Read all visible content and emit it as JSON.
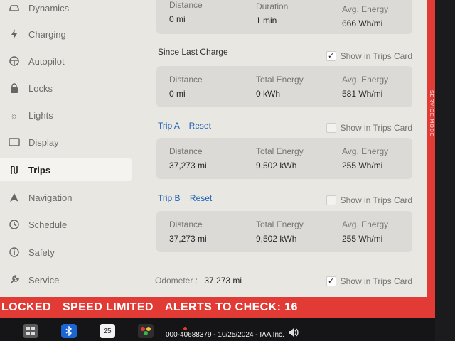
{
  "sidebar": {
    "items": [
      {
        "label": "Dynamics",
        "icon": "car-icon"
      },
      {
        "label": "Charging",
        "icon": "bolt-icon"
      },
      {
        "label": "Autopilot",
        "icon": "steering-wheel-icon"
      },
      {
        "label": "Locks",
        "icon": "lock-icon"
      },
      {
        "label": "Lights",
        "icon": "sun-icon"
      },
      {
        "label": "Display",
        "icon": "display-icon"
      },
      {
        "label": "Trips",
        "icon": "trips-icon",
        "active": true
      },
      {
        "label": "Navigation",
        "icon": "navigation-arrow-icon"
      },
      {
        "label": "Schedule",
        "icon": "clock-icon"
      },
      {
        "label": "Safety",
        "icon": "info-icon"
      },
      {
        "label": "Service",
        "icon": "wrench-icon"
      }
    ]
  },
  "current_drive": {
    "distance_label": "Distance",
    "distance": "0 mi",
    "duration_label": "Duration",
    "duration": "1 min",
    "energy_label": "Avg. Energy",
    "energy": "666 Wh/mi"
  },
  "since_last_charge": {
    "title": "Since Last Charge",
    "show_in_trips_label": "Show in Trips Card",
    "show_in_trips_checked": true,
    "distance_label": "Distance",
    "distance": "0 mi",
    "total_energy_label": "Total Energy",
    "total_energy": "0 kWh",
    "energy_label": "Avg. Energy",
    "energy": "581 Wh/mi"
  },
  "trip_a": {
    "title": "Trip A",
    "reset_label": "Reset",
    "show_in_trips_label": "Show in Trips Card",
    "show_in_trips_checked": false,
    "distance_label": "Distance",
    "distance": "37,273 mi",
    "total_energy_label": "Total Energy",
    "total_energy": "9,502 kWh",
    "energy_label": "Avg. Energy",
    "energy": "255 Wh/mi"
  },
  "trip_b": {
    "title": "Trip B",
    "reset_label": "Reset",
    "show_in_trips_label": "Show in Trips Card",
    "show_in_trips_checked": false,
    "distance_label": "Distance",
    "distance": "37,273 mi",
    "total_energy_label": "Total Energy",
    "total_energy": "9,502 kWh",
    "energy_label": "Avg. Energy",
    "energy": "255 Wh/mi"
  },
  "odometer": {
    "label": "Odometer :",
    "value": "37,273 mi",
    "show_in_trips_label": "Show in Trips Card",
    "show_in_trips_checked": true
  },
  "service_mode_label": "SERVICE MODE",
  "alerts": {
    "locked": "LOCKED",
    "speed_limited": "SPEED LIMITED",
    "alerts_to_check": "ALERTS TO CHECK: 16"
  },
  "taskbar": {
    "calendar_day": "25",
    "watermark": "000-40688379 - 10/25/2024 - IAA Inc."
  },
  "colors": {
    "accent_blue": "#1b5fb8",
    "alert_red": "#e23b36",
    "background": "#e9e7e2",
    "card": "#dcdad6"
  }
}
